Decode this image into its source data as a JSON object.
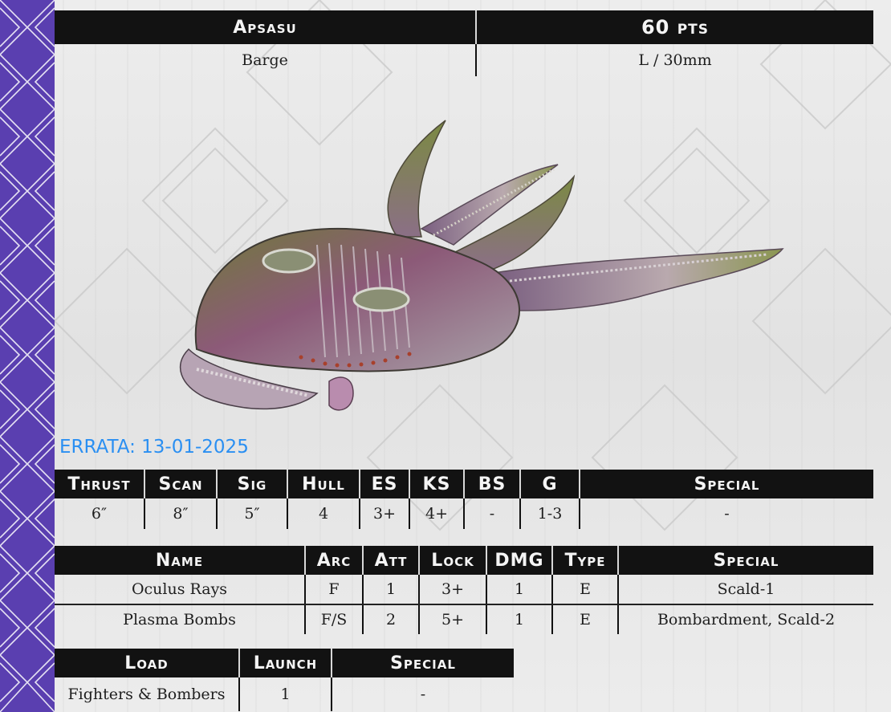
{
  "header": {
    "name": "Apsasu",
    "points": "60 pts",
    "type": "Barge",
    "size": "L / 30mm"
  },
  "errata": "ERRATA: 13-01-2025",
  "stats": {
    "headers": [
      "Thrust",
      "Scan",
      "Sig",
      "Hull",
      "ES",
      "KS",
      "BS",
      "G",
      "Special"
    ],
    "values": [
      "6″",
      "8″",
      "5″",
      "4",
      "3+",
      "4+",
      "-",
      "1-3",
      "-"
    ]
  },
  "weapons": {
    "headers": [
      "Name",
      "Arc",
      "Att",
      "Lock",
      "DMG",
      "Type",
      "Special"
    ],
    "rows": [
      [
        "Oculus Rays",
        "F",
        "1",
        "3+",
        "1",
        "E",
        "Scald-1"
      ],
      [
        "Plasma Bombs",
        "F/S",
        "2",
        "5+",
        "1",
        "E",
        "Bombardment, Scald-2"
      ]
    ]
  },
  "launch": {
    "headers": [
      "Load",
      "Launch",
      "Special"
    ],
    "rows": [
      [
        "Fighters & Bombers",
        "1",
        "-"
      ]
    ]
  },
  "colors": {
    "sidebar": "#5a3fb0",
    "header_bg": "#121212",
    "errata": "#2a8ff2"
  }
}
